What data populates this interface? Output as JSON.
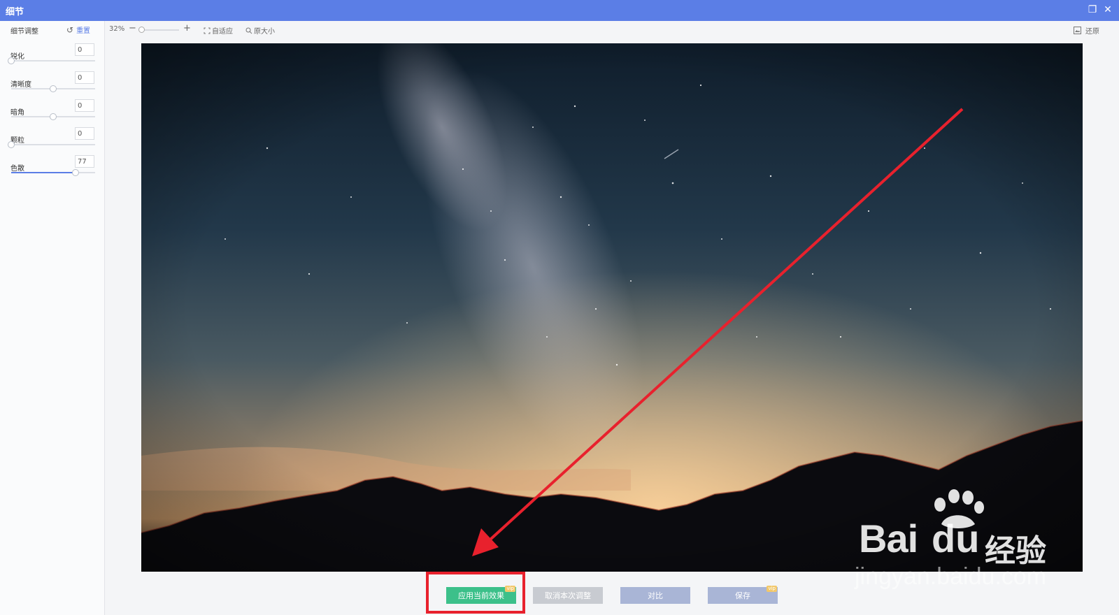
{
  "window": {
    "title": "细节"
  },
  "sidebar": {
    "header_label": "细节调整",
    "reset_label": "重置",
    "adjustments": [
      {
        "label": "锐化",
        "value": "0",
        "level": 0.0
      },
      {
        "label": "清晰度",
        "value": "0",
        "level": 0.5
      },
      {
        "label": "暗角",
        "value": "0",
        "level": 0.5
      },
      {
        "label": "颗粒",
        "value": "0",
        "level": 0.0
      },
      {
        "label": "色散",
        "value": "77",
        "level": 0.77
      }
    ]
  },
  "toolbar": {
    "zoom": "32%",
    "zoom_level": 0.0,
    "minus": "−",
    "plus": "+",
    "fit_label": "自适应",
    "original_size_label": "原大小",
    "restore_label": "还原"
  },
  "buttons": {
    "apply": "应用当前效果",
    "cancel": "取消本次调整",
    "compare": "对比",
    "save": "保存",
    "vip_tag": "vip"
  },
  "watermark": {
    "brand": "Bai",
    "cn": "经验",
    "domain": "jingyan.baidu.com"
  },
  "colors": {
    "titlebar": "#5b7ee6",
    "apply": "#3cc08a",
    "annotation": "#e8212d"
  }
}
